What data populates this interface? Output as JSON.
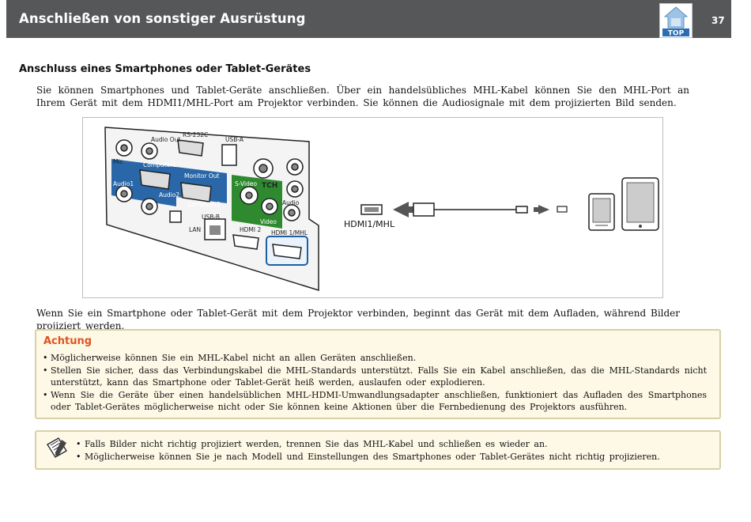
{
  "header": {
    "title": "Anschließen von sonstiger Ausrüstung",
    "page_number": "37",
    "top_button_label": "TOP"
  },
  "section": {
    "title": "Anschluss eines Smartphones oder Tablet-Gerätes",
    "intro": "Sie können Smartphones und Tablet-Geräte anschließen. Über ein handelsübliches MHL-Kabel können Sie den MHL-Port an Ihrem Gerät mit dem HDMI1/MHL-Port am Projektor verbinden. Sie können die Audiosignale mit dem projizierten Bild senden."
  },
  "figure": {
    "labels": {
      "audio_out": "Audio Out",
      "rs232c": "RS-232C",
      "usb_a": "USB-A",
      "mic": "Mic",
      "computer1": "Computer1",
      "monitor_out": "Monitor Out",
      "audio1": "Audio1",
      "audio2": "Audio2",
      "computer2": "Computer2",
      "s_video": "S-Video",
      "tch": "TCH",
      "video": "Video",
      "audio": "Audio",
      "usb_b": "USB-B",
      "lan": "LAN",
      "hdmi2": "HDMI 2",
      "hdmi1_mhl": "HDMI 1/MHL",
      "cable_label": "HDMI1/MHL"
    }
  },
  "note": "Wenn Sie ein Smartphone oder Tablet-Gerät mit dem Projektor verbinden, beginnt das Gerät mit dem Aufladen, während Bilder projiziert werden.",
  "caution": {
    "title": "Achtung",
    "items": [
      "Möglicherweise können Sie ein MHL-Kabel nicht an allen Geräten anschließen.",
      "Stellen Sie sicher, dass das Verbindungskabel die MHL-Standards unterstützt. Falls Sie ein Kabel anschließen, das die MHL-Standards nicht unterstützt, kann das Smartphone oder Tablet-Gerät heiß werden, auslaufen oder explodieren.",
      "Wenn Sie die Geräte über einen handelsüblichen MHL-HDMI-Umwandlungsadapter anschließen, funktioniert das Aufladen des Smartphones oder Tablet-Gerätes möglicherweise nicht oder Sie können keine Aktionen über die Fernbedienung des Projektors ausführen."
    ]
  },
  "tip": {
    "items": [
      "Falls Bilder nicht richtig projiziert werden, trennen Sie das MHL-Kabel und schließen es wieder an.",
      "Möglicherweise können Sie je nach Modell und Einstellungen des Smartphones oder Tablet-Gerätes nicht richtig projizieren."
    ]
  },
  "colors": {
    "header_bg": "#555759",
    "caution_title": "#e0541f",
    "box_bg": "#fdf9e6",
    "box_border": "#d8d0a6",
    "port_blue": "#1e5fa3",
    "port_green": "#2f8a2f"
  },
  "icons": {
    "top": "home-top-icon",
    "tip": "notepad-pencil-icon",
    "bullet": "•"
  }
}
